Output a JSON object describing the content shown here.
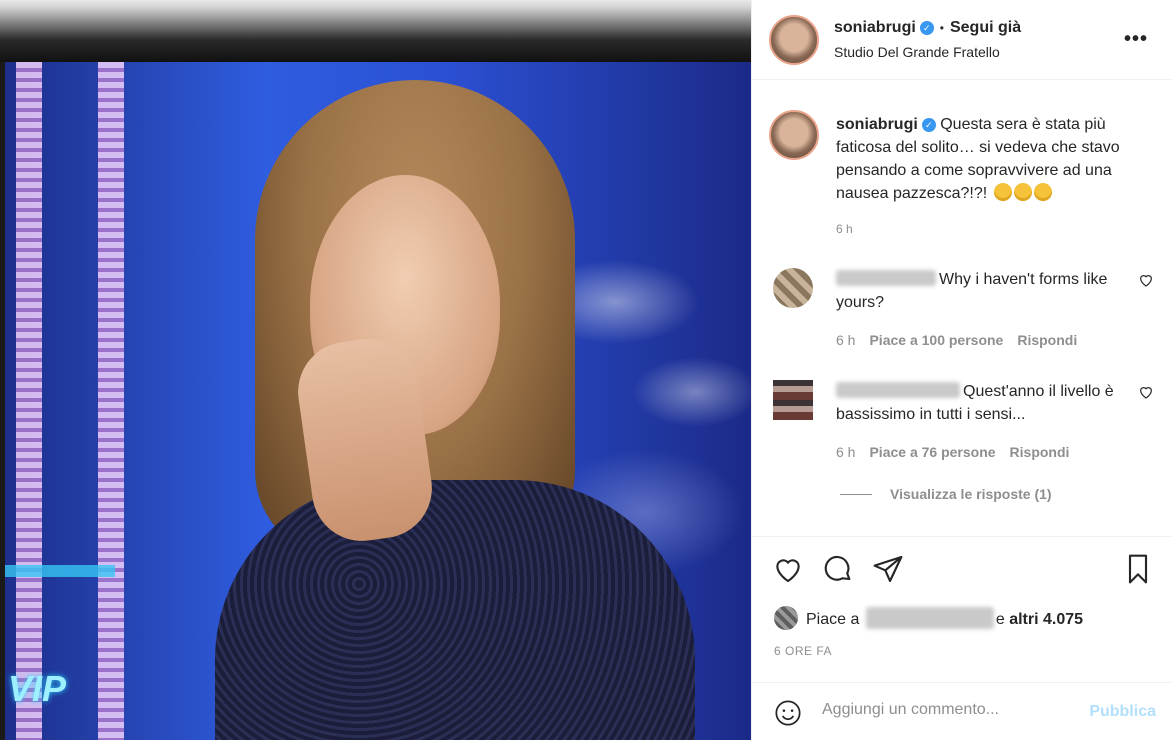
{
  "post": {
    "username": "soniabrugi",
    "follow_label": "Segui già",
    "location": "Studio Del Grande Fratello",
    "image_logo_text": "VIP"
  },
  "caption": {
    "username": "soniabrugi",
    "text": "Questa sera è stata più faticosa del solito… si vedeva che stavo pensando a come sopravvivere ad una nausea pazzesca?!?!",
    "time": "6 h"
  },
  "comments": [
    {
      "text": "Why i haven't forms like yours?",
      "time": "6 h",
      "likes_label": "Piace a 100 persone",
      "reply_label": "Rispondi"
    },
    {
      "text": "Quest'anno il livello è bassissimo in tutti i sensi...",
      "time": "6 h",
      "likes_label": "Piace a 76 persone",
      "reply_label": "Rispondi"
    }
  ],
  "view_replies_label": "Visualizza le risposte (1)",
  "likes": {
    "prefix": "Piace a",
    "middle": "e",
    "others": "altri 4.075"
  },
  "post_date": "6 ORE FA",
  "add_comment": {
    "placeholder": "Aggiungi un commento...",
    "publish_label": "Pubblica"
  },
  "colors": {
    "verified_blue": "#3897f0",
    "publish_disabled": "#b2dffc",
    "secondary_text": "#8e8e8e"
  },
  "icons": [
    "more-options-icon",
    "verified-icon",
    "heart-icon",
    "comment-icon",
    "share-icon",
    "save-icon",
    "emoji-icon"
  ]
}
